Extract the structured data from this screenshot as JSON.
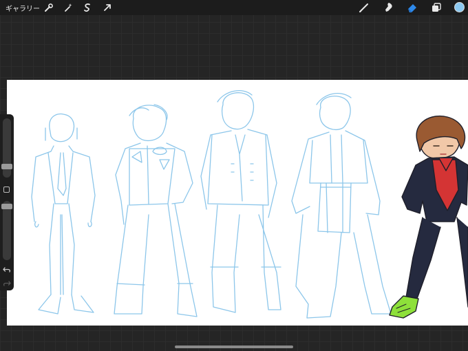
{
  "topbar": {
    "gallery_label": "ギャラリー",
    "left_tools": [
      "wrench-icon",
      "magic-wand-icon",
      "selection-icon",
      "transform-arrow-icon"
    ],
    "right_tools": [
      "brush-icon",
      "smudge-icon",
      "eraser-icon",
      "layers-icon"
    ],
    "active_tool": "eraser-icon",
    "current_color": "#8cc8f0"
  },
  "sidebar": {
    "brush_size": 0.45,
    "brush_opacity": 0.2,
    "icons": [
      "modify-square-icon",
      "undo-icon",
      "redo-icon"
    ]
  },
  "canvas": {
    "sketch_color": "#8cc6ea",
    "figures": [
      "figure-1",
      "figure-2",
      "figure-3",
      "figure-4",
      "figure-5-colored"
    ]
  }
}
